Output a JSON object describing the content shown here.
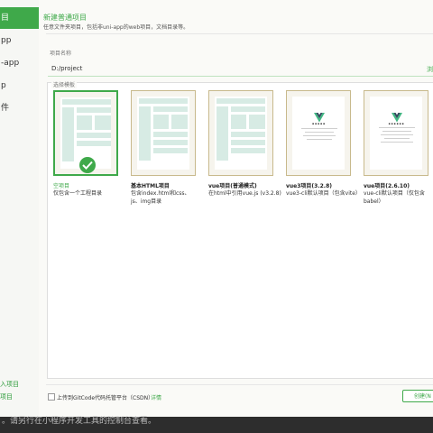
{
  "sidebar": {
    "items": [
      {
        "label": "目",
        "active": true
      },
      {
        "label": "pp",
        "active": false
      },
      {
        "label": "-app",
        "active": false
      },
      {
        "label": "p",
        "active": false
      },
      {
        "label": "件",
        "active": false
      }
    ],
    "links": [
      "入项目",
      "项目"
    ]
  },
  "dialog": {
    "title": "新建普通项目",
    "subtitle": "任意文件夹项目，包括非uni-app的web项目，文档目录等。",
    "name_label": "项目名称",
    "path_value": "D:/project",
    "browse_label": "浏",
    "template_label": "选择模板",
    "templates": [
      {
        "title": "空项目",
        "desc": "仅包含一个工程目录",
        "selected": true
      },
      {
        "title": "基本HTML项目",
        "desc": "包含index.html和css、js、img目录",
        "selected": false
      },
      {
        "title": "vue项目(普通模式)",
        "desc": "在html中引用vue.js (v3.2.8)",
        "selected": false
      },
      {
        "title": "vue3项目(3.2.8)",
        "desc": "vue3-cli默认项目（包含vite）",
        "selected": false
      },
      {
        "title": "vue项目(2.6.10)",
        "desc": "vue-cli默认项目（仅包含babel）",
        "selected": false
      }
    ],
    "upload_label": "上传到GitCode代码托管平台（CSDN）",
    "upload_link": "详情",
    "create_label": "创建(N"
  },
  "console": {
    "text": "。请另行在小程序开发工具的控制台查看。"
  },
  "colors": {
    "accent": "#3fa94a",
    "card_border": "#c8b98c",
    "vue_green": "#41b883",
    "vue_dark": "#35495e"
  }
}
